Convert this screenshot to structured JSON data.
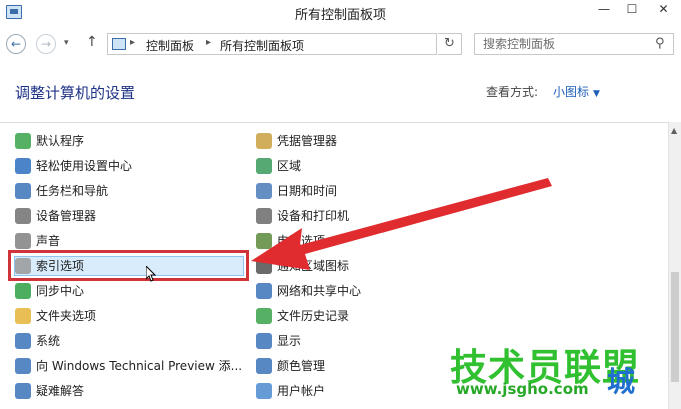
{
  "window": {
    "title": "所有控制面板项",
    "minimize": "—",
    "maximize": "☐",
    "close": "✕"
  },
  "nav": {
    "back": "←",
    "forward": "→",
    "history": "▾",
    "up": "↑",
    "refresh": "↻"
  },
  "breadcrumb": {
    "separator": "▸",
    "items": [
      "控制面板",
      "所有控制面板项"
    ],
    "dropdown": "▾"
  },
  "search": {
    "placeholder": "搜索控制面板",
    "icon": "⚲"
  },
  "header": {
    "title": "调整计算机的设置",
    "view_by_label": "查看方式:",
    "view_by_value": "小图标",
    "caret": "▼"
  },
  "left_items": [
    {
      "label": "默认程序",
      "icon": "default-programs-icon",
      "color": "#3aa34a"
    },
    {
      "label": "轻松使用设置中心",
      "icon": "ease-of-access-icon",
      "color": "#2b6fc0"
    },
    {
      "label": "任务栏和导航",
      "icon": "taskbar-icon",
      "color": "#3a73b8"
    },
    {
      "label": "设备管理器",
      "icon": "device-manager-icon",
      "color": "#707070"
    },
    {
      "label": "声音",
      "icon": "sound-icon",
      "color": "#808080"
    },
    {
      "label": "索引选项",
      "icon": "indexing-icon",
      "color": "#9a9a9a"
    },
    {
      "label": "同步中心",
      "icon": "sync-center-icon",
      "color": "#2ea043"
    },
    {
      "label": "文件夹选项",
      "icon": "folder-options-icon",
      "color": "#e5b437"
    },
    {
      "label": "系统",
      "icon": "system-icon",
      "color": "#3b73b9"
    },
    {
      "label": "向 Windows Technical Preview 添...",
      "icon": "add-features-icon",
      "color": "#3b73b9"
    },
    {
      "label": "疑难解答",
      "icon": "troubleshooting-icon",
      "color": "#3b73b9"
    }
  ],
  "right_items": [
    {
      "label": "凭据管理器",
      "icon": "credential-manager-icon",
      "color": "#c8a040"
    },
    {
      "label": "区域",
      "icon": "region-icon",
      "color": "#3a9a5a"
    },
    {
      "label": "日期和时间",
      "icon": "date-time-icon",
      "color": "#4a7ab8"
    },
    {
      "label": "设备和打印机",
      "icon": "devices-printers-icon",
      "color": "#6a6a6a"
    },
    {
      "label": "电源选项",
      "icon": "power-options-icon",
      "color": "#5a8a3a"
    },
    {
      "label": "通知区域图标",
      "icon": "notification-icon",
      "color": "#505050"
    },
    {
      "label": "网络和共享中心",
      "icon": "network-icon",
      "color": "#3b73b9"
    },
    {
      "label": "文件历史记录",
      "icon": "file-history-icon",
      "color": "#3aa34a"
    },
    {
      "label": "显示",
      "icon": "display-icon",
      "color": "#3b73b9"
    },
    {
      "label": "颜色管理",
      "icon": "color-management-icon",
      "color": "#3b73b9"
    },
    {
      "label": "用户帐户",
      "icon": "user-accounts-icon",
      "color": "#4a8ad0"
    }
  ],
  "watermark": {
    "brand": "技术员联盟",
    "url": "www.jsgho.com",
    "suffix": "城"
  },
  "colors": {
    "highlight": "#d13438",
    "arrow": "#e02b2f",
    "selection": "#d8ecfb"
  }
}
